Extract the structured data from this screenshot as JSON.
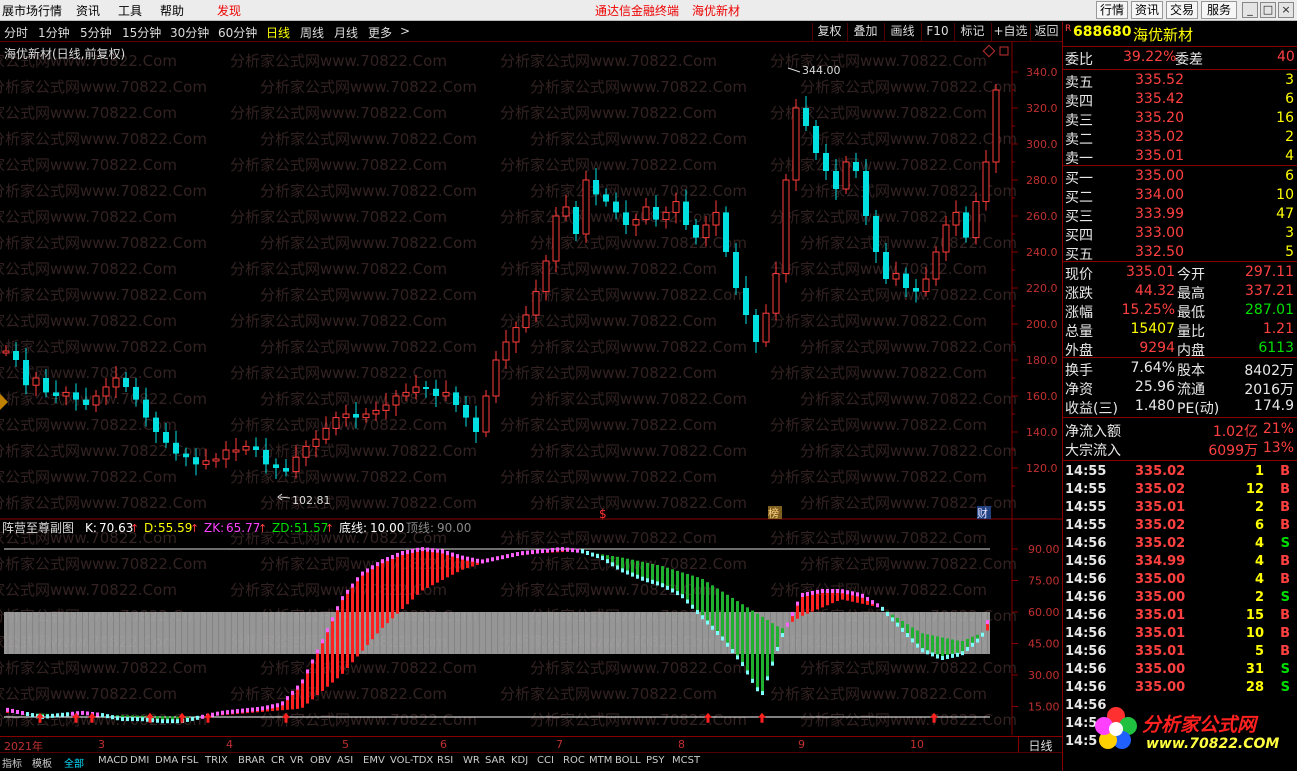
{
  "titlebar": {
    "menu": [
      "展市场行情",
      "资讯",
      "工具",
      "帮助"
    ],
    "discover": "发现",
    "app_title": "通达信金融终端",
    "stock_title": "海优新材",
    "right_buttons": [
      "行情",
      "资讯",
      "交易",
      "服务"
    ],
    "colors": {
      "accent": "#e00000"
    }
  },
  "periodbar": {
    "periods": [
      "分时",
      "1分钟",
      "5分钟",
      "15分钟",
      "30分钟",
      "60分钟",
      "日线",
      "周线",
      "月线",
      "更多"
    ],
    "active": "日线",
    "more_arrow": ">",
    "tools": [
      "复权",
      "叠加",
      "画线",
      "F10",
      "标记",
      "+自选",
      "返回"
    ]
  },
  "main_chart": {
    "title": "海优新材(日线,前复权)",
    "high_label": "344.00",
    "low_label": "102.81",
    "y_ticks": [
      "340.0",
      "320.0",
      "300.0",
      "280.0",
      "260.0",
      "240.0",
      "220.0",
      "200.0",
      "180.0",
      "160.0",
      "140.0",
      "120.0"
    ],
    "watermark": "分析家公式网www.70822.Com",
    "markers": [
      "$",
      "榜",
      "财"
    ]
  },
  "sub_chart": {
    "name": "阵营至尊副图",
    "indicators": [
      {
        "label": "K:",
        "value": "70.63",
        "color": "#ffffff"
      },
      {
        "label": "D:",
        "value": "55.59",
        "color": "#ffff00"
      },
      {
        "label": "ZK:",
        "value": "65.77",
        "color": "#ff40ff"
      },
      {
        "label": "ZD:",
        "value": "51.57",
        "color": "#00e000"
      }
    ],
    "bottom_line": {
      "label": "底线:",
      "value": "10.00"
    },
    "top_line": {
      "label": "顶线:",
      "value": "90.00"
    },
    "y_ticks": [
      "90.00",
      "75.00",
      "60.00",
      "45.00",
      "30.00",
      "15.00"
    ]
  },
  "date_axis": {
    "labels": [
      "2021年",
      "3",
      "4",
      "5",
      "6",
      "7",
      "8",
      "9",
      "10"
    ],
    "period": "日线"
  },
  "tabs": {
    "items": [
      "指标",
      "模板",
      "全部",
      "MACD",
      "DMI",
      "DMA",
      "FSL",
      "TRIX",
      "BRAR",
      "CR",
      "VR",
      "OBV",
      "ASI",
      "EMV",
      "VOL-TDX",
      "RSI",
      "WR",
      "SAR",
      "KDJ",
      "CCI",
      "ROC",
      "MTM",
      "BOLL",
      "PSY",
      "MCST"
    ],
    "active": "全部"
  },
  "right_panel": {
    "code": "688680",
    "name": "海优新材",
    "r_badge": "R",
    "weibi": {
      "label": "委比",
      "value": "39.22%",
      "diff_label": "委差",
      "diff": "40"
    },
    "sell": [
      {
        "label": "卖五",
        "price": "335.52",
        "vol": "3"
      },
      {
        "label": "卖四",
        "price": "335.42",
        "vol": "6"
      },
      {
        "label": "卖三",
        "price": "335.20",
        "vol": "16"
      },
      {
        "label": "卖二",
        "price": "335.02",
        "vol": "2"
      },
      {
        "label": "卖一",
        "price": "335.01",
        "vol": "4"
      }
    ],
    "buy": [
      {
        "label": "买一",
        "price": "335.00",
        "vol": "6"
      },
      {
        "label": "买二",
        "price": "334.00",
        "vol": "10"
      },
      {
        "label": "买三",
        "price": "333.99",
        "vol": "47"
      },
      {
        "label": "买四",
        "price": "333.00",
        "vol": "3"
      },
      {
        "label": "买五",
        "price": "332.50",
        "vol": "5"
      }
    ],
    "stats": [
      {
        "l1": "现价",
        "v1": "335.01",
        "c1": "red",
        "l2": "今开",
        "v2": "297.11",
        "c2": "red"
      },
      {
        "l1": "涨跌",
        "v1": "44.32",
        "c1": "red",
        "l2": "最高",
        "v2": "337.21",
        "c2": "red"
      },
      {
        "l1": "涨幅",
        "v1": "15.25%",
        "c1": "red",
        "l2": "最低",
        "v2": "287.01",
        "c2": "green"
      },
      {
        "l1": "总量",
        "v1": "15407",
        "c1": "yellow",
        "l2": "量比",
        "v2": "1.21",
        "c2": "red"
      },
      {
        "l1": "外盘",
        "v1": "9294",
        "c1": "red",
        "l2": "内盘",
        "v2": "6113",
        "c2": "green"
      }
    ],
    "stats2": [
      {
        "l1": "换手",
        "v1": "7.64%",
        "l2": "股本",
        "v2": "8402万"
      },
      {
        "l1": "净资",
        "v1": "25.96",
        "l2": "流通",
        "v2": "2016万"
      },
      {
        "l1": "收益(三)",
        "v1": "1.480",
        "l2": "PE(动)",
        "v2": "174.9"
      }
    ],
    "flow": [
      {
        "label": "净流入额",
        "value": "1.02亿",
        "pct": "21%"
      },
      {
        "label": "大宗流入",
        "value": "6099万",
        "pct": "13%"
      }
    ],
    "ticks": [
      {
        "t": "14:55",
        "p": "335.02",
        "v": "1",
        "s": "B"
      },
      {
        "t": "14:55",
        "p": "335.02",
        "v": "12",
        "s": "B"
      },
      {
        "t": "14:55",
        "p": "335.01",
        "v": "2",
        "s": "B"
      },
      {
        "t": "14:55",
        "p": "335.02",
        "v": "6",
        "s": "B"
      },
      {
        "t": "14:56",
        "p": "335.02",
        "v": "4",
        "s": "S"
      },
      {
        "t": "14:56",
        "p": "334.99",
        "v": "4",
        "s": "B"
      },
      {
        "t": "14:56",
        "p": "335.00",
        "v": "4",
        "s": "B"
      },
      {
        "t": "14:56",
        "p": "335.00",
        "v": "2",
        "s": "S"
      },
      {
        "t": "14:56",
        "p": "335.01",
        "v": "15",
        "s": "B"
      },
      {
        "t": "14:56",
        "p": "335.01",
        "v": "10",
        "s": "B"
      },
      {
        "t": "14:56",
        "p": "335.01",
        "v": "5",
        "s": "B"
      },
      {
        "t": "14:56",
        "p": "335.00",
        "v": "31",
        "s": "S"
      },
      {
        "t": "14:56",
        "p": "335.00",
        "v": "28",
        "s": "S"
      },
      {
        "t": "14:56",
        "p": "",
        "v": "",
        "s": ""
      },
      {
        "t": "14:5",
        "p": "",
        "v": "",
        "s": ""
      },
      {
        "t": "14:5",
        "p": "",
        "v": "",
        "s": ""
      }
    ]
  },
  "logo": {
    "text": "分析家公式网",
    "url": "www.70822.COM"
  }
}
